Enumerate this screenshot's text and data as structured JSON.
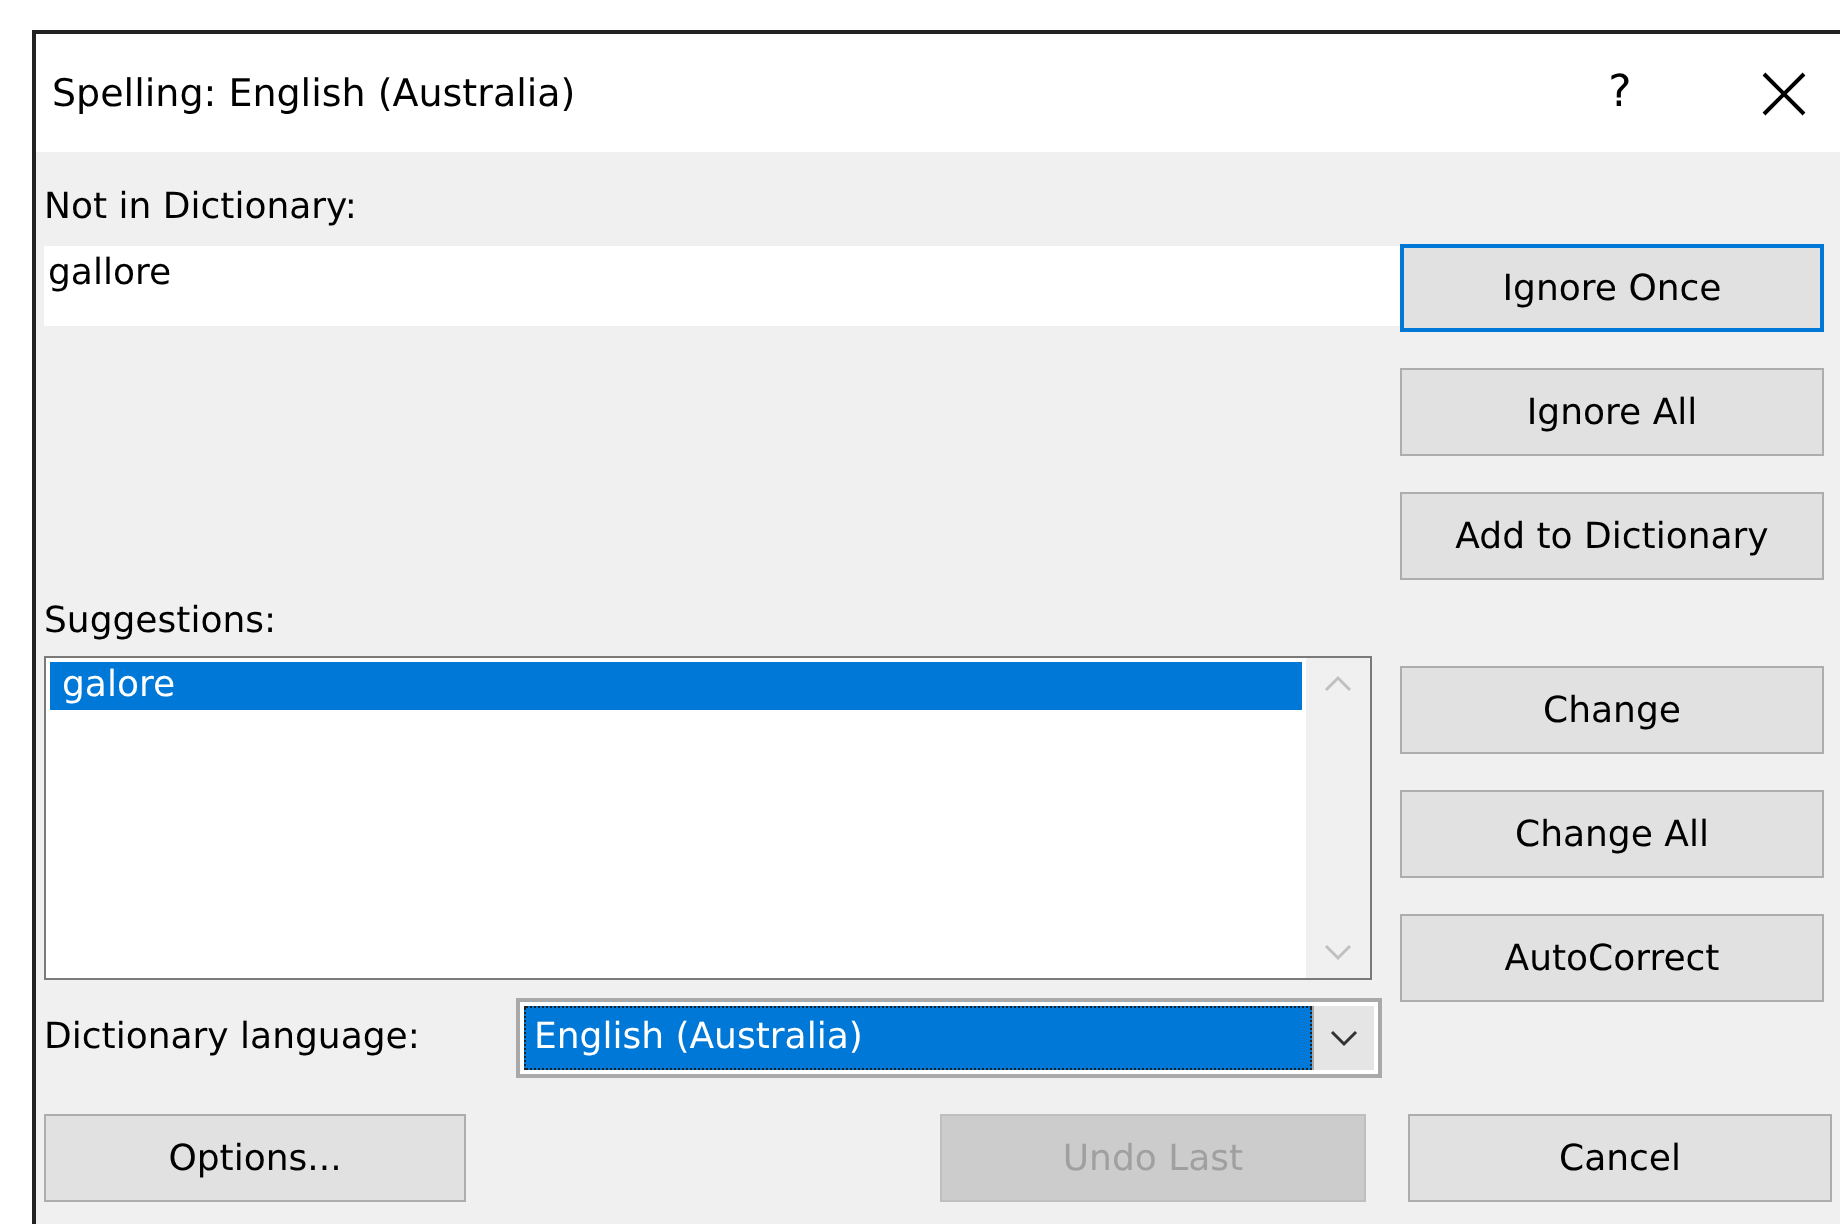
{
  "window": {
    "title": "Spelling: English (Australia)",
    "help": "?"
  },
  "not_in_dictionary": {
    "label": "Not in Dictionary:",
    "value": "gallore"
  },
  "suggestions": {
    "label": "Suggestions:",
    "items": [
      {
        "text": "galore",
        "selected": true
      }
    ]
  },
  "dictionary_language": {
    "label": "Dictionary language:",
    "value": "English (Australia)",
    "focused": true
  },
  "top_buttons": [
    {
      "label": "Ignore Once",
      "default": true,
      "disabled": false
    },
    {
      "label": "Ignore All",
      "default": false,
      "disabled": false
    },
    {
      "label": "Add to Dictionary",
      "default": false,
      "disabled": false
    }
  ],
  "middle_buttons": [
    {
      "label": "Change",
      "default": false,
      "disabled": false
    },
    {
      "label": "Change All",
      "default": false,
      "disabled": false
    },
    {
      "label": "AutoCorrect",
      "default": false,
      "disabled": false
    }
  ],
  "bottom_buttons": [
    {
      "label": "Options...",
      "default": false,
      "disabled": false
    },
    {
      "label": "Undo Last",
      "default": false,
      "disabled": true
    },
    {
      "label": "Cancel",
      "default": false,
      "disabled": false
    }
  ]
}
